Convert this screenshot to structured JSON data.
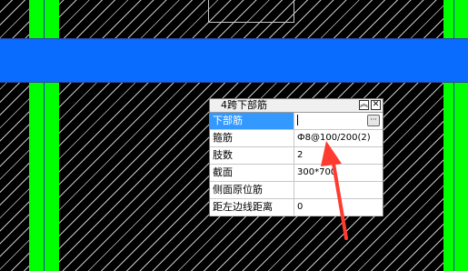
{
  "panel": {
    "title": "4跨下部筋",
    "collapse_icon": "double-chevron-up-icon",
    "close_icon": "close-icon",
    "more_label": "···",
    "rows": [
      {
        "name": "下部筋",
        "value": ""
      },
      {
        "name": "箍筋",
        "value": "Ф8@100/200(2)"
      },
      {
        "name": "肢数",
        "value": "2"
      },
      {
        "name": "截面",
        "value": "300*700"
      },
      {
        "name": "侧面原位筋",
        "value": ""
      },
      {
        "name": "距左边线距离",
        "value": "0"
      }
    ]
  },
  "colors": {
    "column": "#00ff00",
    "beam": "#0a6cff",
    "selection": "#3399ff",
    "annotation_arrow": "#ff3b30"
  }
}
